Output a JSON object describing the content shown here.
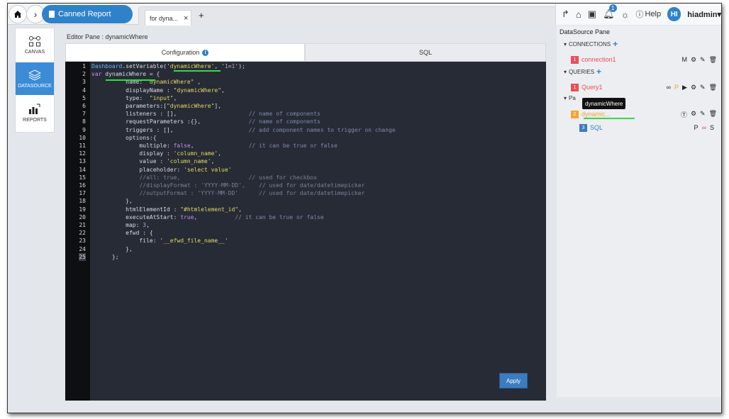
{
  "header": {
    "breadcrumb": "Canned Report",
    "tab_label": "for dyna...",
    "tab_close": "×",
    "add_tab": "+",
    "notification_count": "1",
    "help_label": "Help",
    "avatar_initials": "HI",
    "username": "hiadmin"
  },
  "sidebar": {
    "items": [
      {
        "label": "CANVAS",
        "icon": "canvas-icon"
      },
      {
        "label": "DATASOURCE",
        "icon": "database-icon",
        "active": true
      },
      {
        "label": "REPORTS",
        "icon": "bar-chart-icon"
      }
    ]
  },
  "editor": {
    "title": "Editor Pane : dynamicWhere",
    "tabs": [
      "Configuration",
      "SQL"
    ],
    "apply_label": "Apply",
    "line_numbers": [
      "1",
      "2",
      "3",
      "4",
      "5",
      "6",
      "7",
      "8",
      "9",
      "10",
      "11",
      "12",
      "13",
      "14",
      "15",
      "16",
      "17",
      "18",
      "19",
      "20",
      "21",
      "22",
      "23",
      "24",
      "25"
    ],
    "code_lines": [
      "Dashboard.setVariable('dynamicWhere', '1=1');",
      "var dynamicWhere = {",
      "          name: \"dynamicWhere\" ,",
      "          displayName : \"dynamicWhere\",",
      "          type:  \"input\",",
      "          parameters:[\"dynamicWhere\"],",
      "          listeners : [],                     // name of components",
      "          requestParameters :{},              // name of components",
      "          triggers : [],                      // add component names to trigger on change",
      "          options:{",
      "              multiple: false,                // it can be true or false",
      "              display : 'column_name',",
      "              value : 'column_name',",
      "              placeholder: 'select value'",
      "              //all: true,                    // used for checkbox",
      "              //displayFormat : 'YYYY-MM-DD',    // used for date/datetimepicker",
      "              //outputFormat : 'YYYY-MM-DD'      // used for date/datetimepicker",
      "          },",
      "          htmlElementId : \"#htmlelement_id\",",
      "          executeAtStart: true,           // it can be true or false",
      "          map: 3,",
      "          efwd : {",
      "              file: '__efwd_file_name__'",
      "          },",
      "      };"
    ]
  },
  "datasource": {
    "title": "DataSource Pane",
    "connections_label": "CONNECTIONS",
    "connection": {
      "num": "1",
      "name": "connection1",
      "flag": "M"
    },
    "queries_label": "QUERIES",
    "query": {
      "num": "1",
      "name": "Query1",
      "flag": "P"
    },
    "params_label": "Pa",
    "tooltip": "dynamicWhere",
    "param": {
      "num": "2",
      "name": "dynamic..."
    },
    "sql": {
      "num": "3",
      "name": "SQL",
      "flag1": "P",
      "flag2": "S"
    }
  },
  "colors": {
    "accent": "#2f82c9",
    "red": "#e8505b",
    "orange": "#f2a531",
    "green": "#2ddf3e"
  }
}
